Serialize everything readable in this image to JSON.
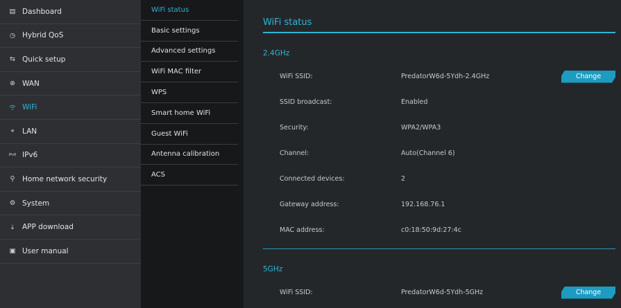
{
  "sidebar": {
    "items": [
      {
        "label": "Dashboard",
        "icon": "▤"
      },
      {
        "label": "Hybrid QoS",
        "icon": "◷"
      },
      {
        "label": "Quick setup",
        "icon": "⇆"
      },
      {
        "label": "WAN",
        "icon": "⊕"
      },
      {
        "label": "WiFi",
        "icon": "ᯤ"
      },
      {
        "label": "LAN",
        "icon": "⌖"
      },
      {
        "label": "IPv6",
        "icon": "IPv6"
      },
      {
        "label": "Home network security",
        "icon": "⚲"
      },
      {
        "label": "System",
        "icon": "⚙"
      },
      {
        "label": "APP download",
        "icon": "⤓"
      },
      {
        "label": "User manual",
        "icon": "▣"
      }
    ],
    "active": "WiFi"
  },
  "submenu": {
    "items": [
      "WiFi status",
      "Basic settings",
      "Advanced settings",
      "WiFi MAC filter",
      "WPS",
      "Smart home WiFi",
      "Guest WiFi",
      "Antenna calibration",
      "ACS"
    ],
    "active": "WiFi status"
  },
  "main": {
    "title": "WiFi status",
    "band24": {
      "title": "2.4GHz",
      "rows": {
        "ssid": {
          "label": "WiFi SSID:",
          "value": "PredatorW6d-5Ydh-2.4GHz"
        },
        "broadcast": {
          "label": "SSID broadcast:",
          "value": "Enabled"
        },
        "security": {
          "label": "Security:",
          "value": "WPA2/WPA3"
        },
        "channel": {
          "label": "Channel:",
          "value": "Auto(Channel 6)"
        },
        "devices": {
          "label": "Connected devices:",
          "value": "2"
        },
        "gateway": {
          "label": "Gateway address:",
          "value": "192.168.76.1"
        },
        "mac": {
          "label": "MAC address:",
          "value": "c0:18:50:9d:27:4c"
        }
      },
      "change_label": "Change"
    },
    "band5": {
      "title": "5GHz",
      "rows": {
        "ssid": {
          "label": "WiFi SSID:",
          "value": "PredatorW6d-5Ydh-5GHz"
        }
      },
      "change_label": "Change"
    }
  },
  "colors": {
    "accent": "#2fb6d6",
    "button": "#1c9cc0",
    "sidebar_bg": "#2d2f32",
    "content_bg": "#24272a"
  }
}
